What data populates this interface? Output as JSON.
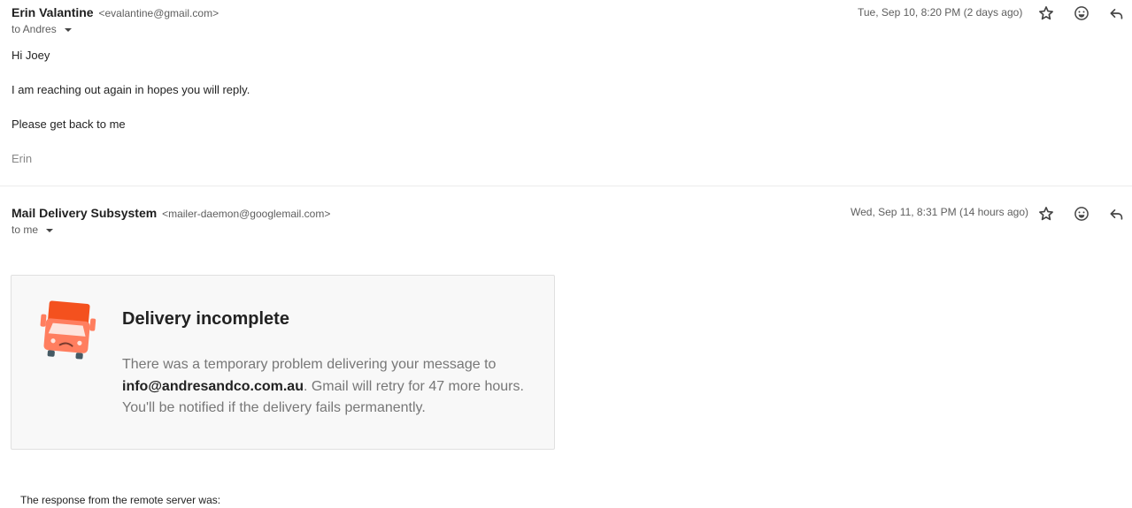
{
  "messages": [
    {
      "sender_name": "Erin Valantine",
      "sender_email": "<evalantine@gmail.com>",
      "to_label": "to Andres",
      "date": "Tue, Sep 10, 8:20 PM (2 days ago)",
      "actions": {
        "star": "star-icon",
        "react": "emoji-icon",
        "reply": "reply-icon"
      },
      "body": [
        "Hi Joey",
        "I am reaching out again in hopes you will reply.",
        "Please get back to me"
      ],
      "signature": "Erin"
    },
    {
      "sender_name": "Mail Delivery Subsystem",
      "sender_email": "<mailer-daemon@googlemail.com>",
      "to_label": "to me",
      "date": "Wed, Sep 11, 8:31 PM (14 hours ago)",
      "actions": {
        "star": "star-icon",
        "react": "emoji-icon",
        "reply": "reply-icon"
      },
      "card": {
        "icon": "sad-truck-icon",
        "title": "Delivery incomplete",
        "text_before": "There was a temporary problem delivering your message to ",
        "recipient": "info@andresandco.com.au",
        "text_after": ". Gmail will retry for 47 more hours. You'll be notified if the delivery fails permanently."
      },
      "response_label": "The response from the remote server was:"
    }
  ],
  "colors": {
    "truck_top": "#f4511e",
    "truck_body": "#ff7e5f",
    "card_bg": "#f8f8f8"
  }
}
